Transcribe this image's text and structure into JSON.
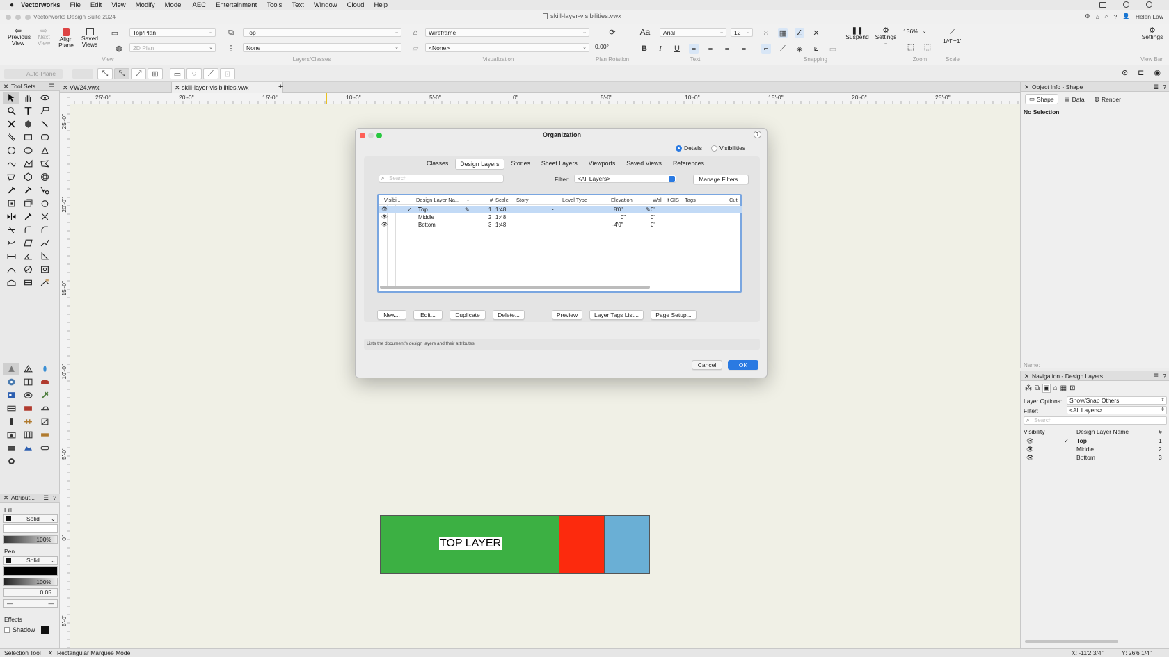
{
  "menubar": {
    "app": "Vectorworks",
    "items": [
      "File",
      "Edit",
      "View",
      "Modify",
      "Model",
      "AEC",
      "Entertainment",
      "Tools",
      "Text",
      "Window",
      "Cloud",
      "Help"
    ]
  },
  "titlebar": {
    "app_title": "Vectorworks Design Suite 2024",
    "doc_title": "skill-layer-visibilities.vwx",
    "user": "Helen Law"
  },
  "toolbar": {
    "prev_view": "Previous View",
    "next_view": "Next View",
    "align_plane": "Align Plane",
    "saved_views": "Saved Views",
    "view_dd": "Top/Plan",
    "plane_dd": "2D Plan",
    "layer_dd": "Top",
    "class_dd": "None",
    "render_dd": "Wireframe",
    "render2_dd": "<None>",
    "rotation_value": "0.00°",
    "font_dd": "Arial",
    "size_dd": "12",
    "suspend": "Suspend",
    "settings": "Settings",
    "zoom_dd": "136%",
    "scale": "1/4\"=1'",
    "settings_right": "Settings",
    "groups": {
      "view": "View",
      "layers": "Layers/Classes",
      "vis": "Visualization",
      "rot": "Plan Rotation",
      "text": "Text",
      "snap": "Snapping",
      "zoom": "Zoom",
      "scale": "Scale",
      "viewbar": "View Bar"
    }
  },
  "modebar": {
    "auto_plane": "Auto-Plane"
  },
  "toolsets": {
    "title": "Tool Sets"
  },
  "attributes": {
    "title": "Attribut...",
    "fill_label": "Fill",
    "fill_style": "Solid",
    "fill_opacity": "100%",
    "pen_label": "Pen",
    "pen_style": "Solid",
    "pen_opacity": "100%",
    "line_weight": "0.05",
    "effects_label": "Effects",
    "shadow_label": "Shadow"
  },
  "tabs": [
    {
      "label": "VW24.vwx"
    },
    {
      "label": "skill-layer-visibilities.vwx"
    }
  ],
  "ruler": {
    "h_labels": [
      "25'-0\"",
      "20'-0\"",
      "15'-0\"",
      "10'-0\"",
      "5'-0\"",
      "0\"",
      "5'-0\"",
      "10'-0\"",
      "15'-0\"",
      "20'-0\"",
      "25'-0\""
    ],
    "v_labels": [
      "25'-0\"",
      "20'-0\"",
      "15'-0\"",
      "10'-0\"",
      "5'-0\"",
      "0\"",
      "5'-0\""
    ]
  },
  "canvas": {
    "label": "TOP LAYER",
    "colors": {
      "green": "#3cb043",
      "red": "#fc2a0d",
      "blue": "#6aafd5"
    }
  },
  "dialog": {
    "title": "Organization",
    "mode_details": "Details",
    "mode_visibilities": "Visibilities",
    "tabs": [
      "Classes",
      "Design Layers",
      "Stories",
      "Sheet Layers",
      "Viewports",
      "Saved Views",
      "References"
    ],
    "search_placeholder": "Search",
    "filter_label": "Filter:",
    "filter_value": "<All Layers>",
    "manage_filters": "Manage Filters...",
    "columns": [
      "Visibil...",
      "Design Layer Na...",
      "#",
      "Scale",
      "Story",
      "Level Type",
      "Elevation",
      "Wall Ht",
      "GIS",
      "Tags",
      "Cut"
    ],
    "rows": [
      {
        "name": "Top",
        "num": "1",
        "scale": "1:48",
        "elevation": "8'0\"",
        "wallht": "0\""
      },
      {
        "name": "Middle",
        "num": "2",
        "scale": "1:48",
        "elevation": "0\"",
        "wallht": "0\""
      },
      {
        "name": "Bottom",
        "num": "3",
        "scale": "1:48",
        "elevation": "-4'0\"",
        "wallht": "0\""
      }
    ],
    "buttons": [
      "New...",
      "Edit...",
      "Duplicate",
      "Delete...",
      "Preview",
      "Layer Tags List...",
      "Page Setup..."
    ],
    "hint": "Lists the document's design layers and their attributes.",
    "cancel": "Cancel",
    "ok": "OK"
  },
  "objinfo": {
    "title": "Object Info - Shape",
    "tabs": [
      "Shape",
      "Data",
      "Render"
    ],
    "selection": "No Selection",
    "name_label": "Name:"
  },
  "nav": {
    "title": "Navigation - Design Layers",
    "layer_options_label": "Layer Options:",
    "layer_options_value": "Show/Snap Others",
    "filter_label": "Filter:",
    "filter_value": "<All Layers>",
    "search_placeholder": "Search",
    "col_visibility": "Visibility",
    "col_name": "Design Layer Name",
    "col_num": "#",
    "rows": [
      {
        "name": "Top",
        "num": "1"
      },
      {
        "name": "Middle",
        "num": "2"
      },
      {
        "name": "Bottom",
        "num": "3"
      }
    ]
  },
  "status": {
    "tool": "Selection Tool",
    "mode": "Rectangular Marquee Mode",
    "x": "X: -11'2 3/4\"",
    "y": "Y: 26'6 1/4\""
  }
}
